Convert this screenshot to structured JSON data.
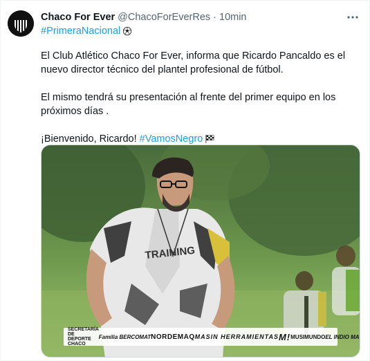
{
  "tweet": {
    "display_name": "Chaco For Ever",
    "handle": "@ChacoForEverRes",
    "separator": "·",
    "time": "10min",
    "avatar_text": "CHACO FOR EVER",
    "hashtag_line": "#PrimeraNacional",
    "hashtag_line_emoji": "soccer-ball-icon",
    "paragraph_1": "El Club Atlético Chaco For Ever, informa que Ricardo Pancaldo es el nuevo director técnico del plantel profesional de fútbol.",
    "paragraph_2": "El mismo tendrá su presentación al frente del primer equipo en los próximos días .",
    "paragraph_3_text": "¡Bienvenido, Ricardo! ",
    "paragraph_3_hashtag": "#VamosNegro",
    "paragraph_3_emoji": "checkered-flag-icon"
  },
  "media": {
    "shirt_text": "TRAINING",
    "sponsors": [
      "SECRETARÍA DE DEPORTE CHACO",
      "Familia BERCOMAT",
      "NORDEMAQ",
      "MASIN HERRAMIENTAS",
      "M!",
      "MUSIMUNDO",
      "EL INDIO MAYORISTA"
    ]
  },
  "colors": {
    "link": "#1d9bf0",
    "text": "#0f1419",
    "secondary": "#536471"
  }
}
